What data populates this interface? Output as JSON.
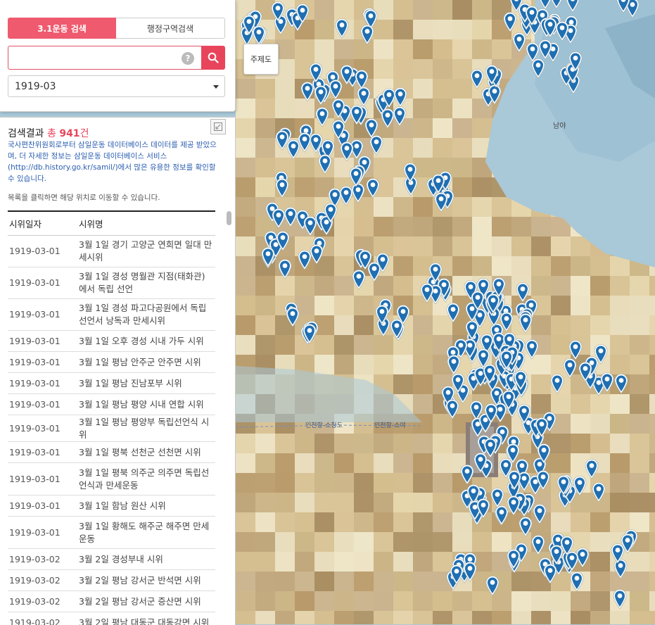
{
  "search_panel": {
    "tab_active": "3.1운동 검색",
    "tab_inactive": "행정구역검색",
    "search_value": "",
    "help_symbol": "?",
    "date_value": "1919-03"
  },
  "map": {
    "theme_button": "주제도",
    "labels": [
      "인천항-소청도",
      "인천항-소야",
      "남야"
    ]
  },
  "results": {
    "title_prefix": "검색결과",
    "title_total_word": "총",
    "title_count": "941",
    "title_suffix": "건",
    "notice": "국사편찬위원회로부터 삼일운동 데이터베이스 데이터를 제공 받았으며, 더 자세한 정보는 삼일운동 데이터베이스 서비스(http://db.history.go.kr/samil/)에서 많은 유용한 정보를 확인할 수 있습니다.",
    "hint": "목록을 클릭하면 해당 위치로 이동할 수 있습니다.",
    "columns": [
      "시위일자",
      "시위명"
    ],
    "rows": [
      {
        "date": "1919-03-01",
        "name": "3월 1일 경기 고양군 연희면 일대 만세시위"
      },
      {
        "date": "1919-03-01",
        "name": "3월 1일 경성 명월관 지점(태화관)에서 독립 선언"
      },
      {
        "date": "1919-03-01",
        "name": "3월 1일 경성 파고다공원에서 독립선언서 낭독과 만세시위"
      },
      {
        "date": "1919-03-01",
        "name": "3월 1일 오후 경성 시내 가두 시위"
      },
      {
        "date": "1919-03-01",
        "name": "3월 1일 평남 안주군 안주면 시위"
      },
      {
        "date": "1919-03-01",
        "name": "3월 1일 평남 진남포부 시위"
      },
      {
        "date": "1919-03-01",
        "name": "3월 1일 평남 평양 시내 연합 시위"
      },
      {
        "date": "1919-03-01",
        "name": "3월 1일 평남 평양부 독립선언식 시위"
      },
      {
        "date": "1919-03-01",
        "name": "3월 1일 평북 선천군 선천면 시위"
      },
      {
        "date": "1919-03-01",
        "name": "3월 1일 평북 의주군 의주면 독립선언식과 만세운동"
      },
      {
        "date": "1919-03-01",
        "name": "3월 1일 함남 원산 시위"
      },
      {
        "date": "1919-03-01",
        "name": "3월 1일 황해도 해주군 해주면 만세운동"
      },
      {
        "date": "1919-03-02",
        "name": "3월 2일 경성부내 시위"
      },
      {
        "date": "1919-03-02",
        "name": "3월 2일 평남 강서군 반석면 시위"
      },
      {
        "date": "1919-03-02",
        "name": "3월 2일 평남 강서군 증산면 시위"
      },
      {
        "date": "1919-03-02",
        "name": "3월 2일 평남 대동군 대동강면 시위"
      }
    ]
  },
  "colors": {
    "accent": "#e8455c",
    "tab_active": "#ef5a6e",
    "marker": "#1f6fb2",
    "sea": "#a9c8d8",
    "link_text": "#2a5db0"
  }
}
